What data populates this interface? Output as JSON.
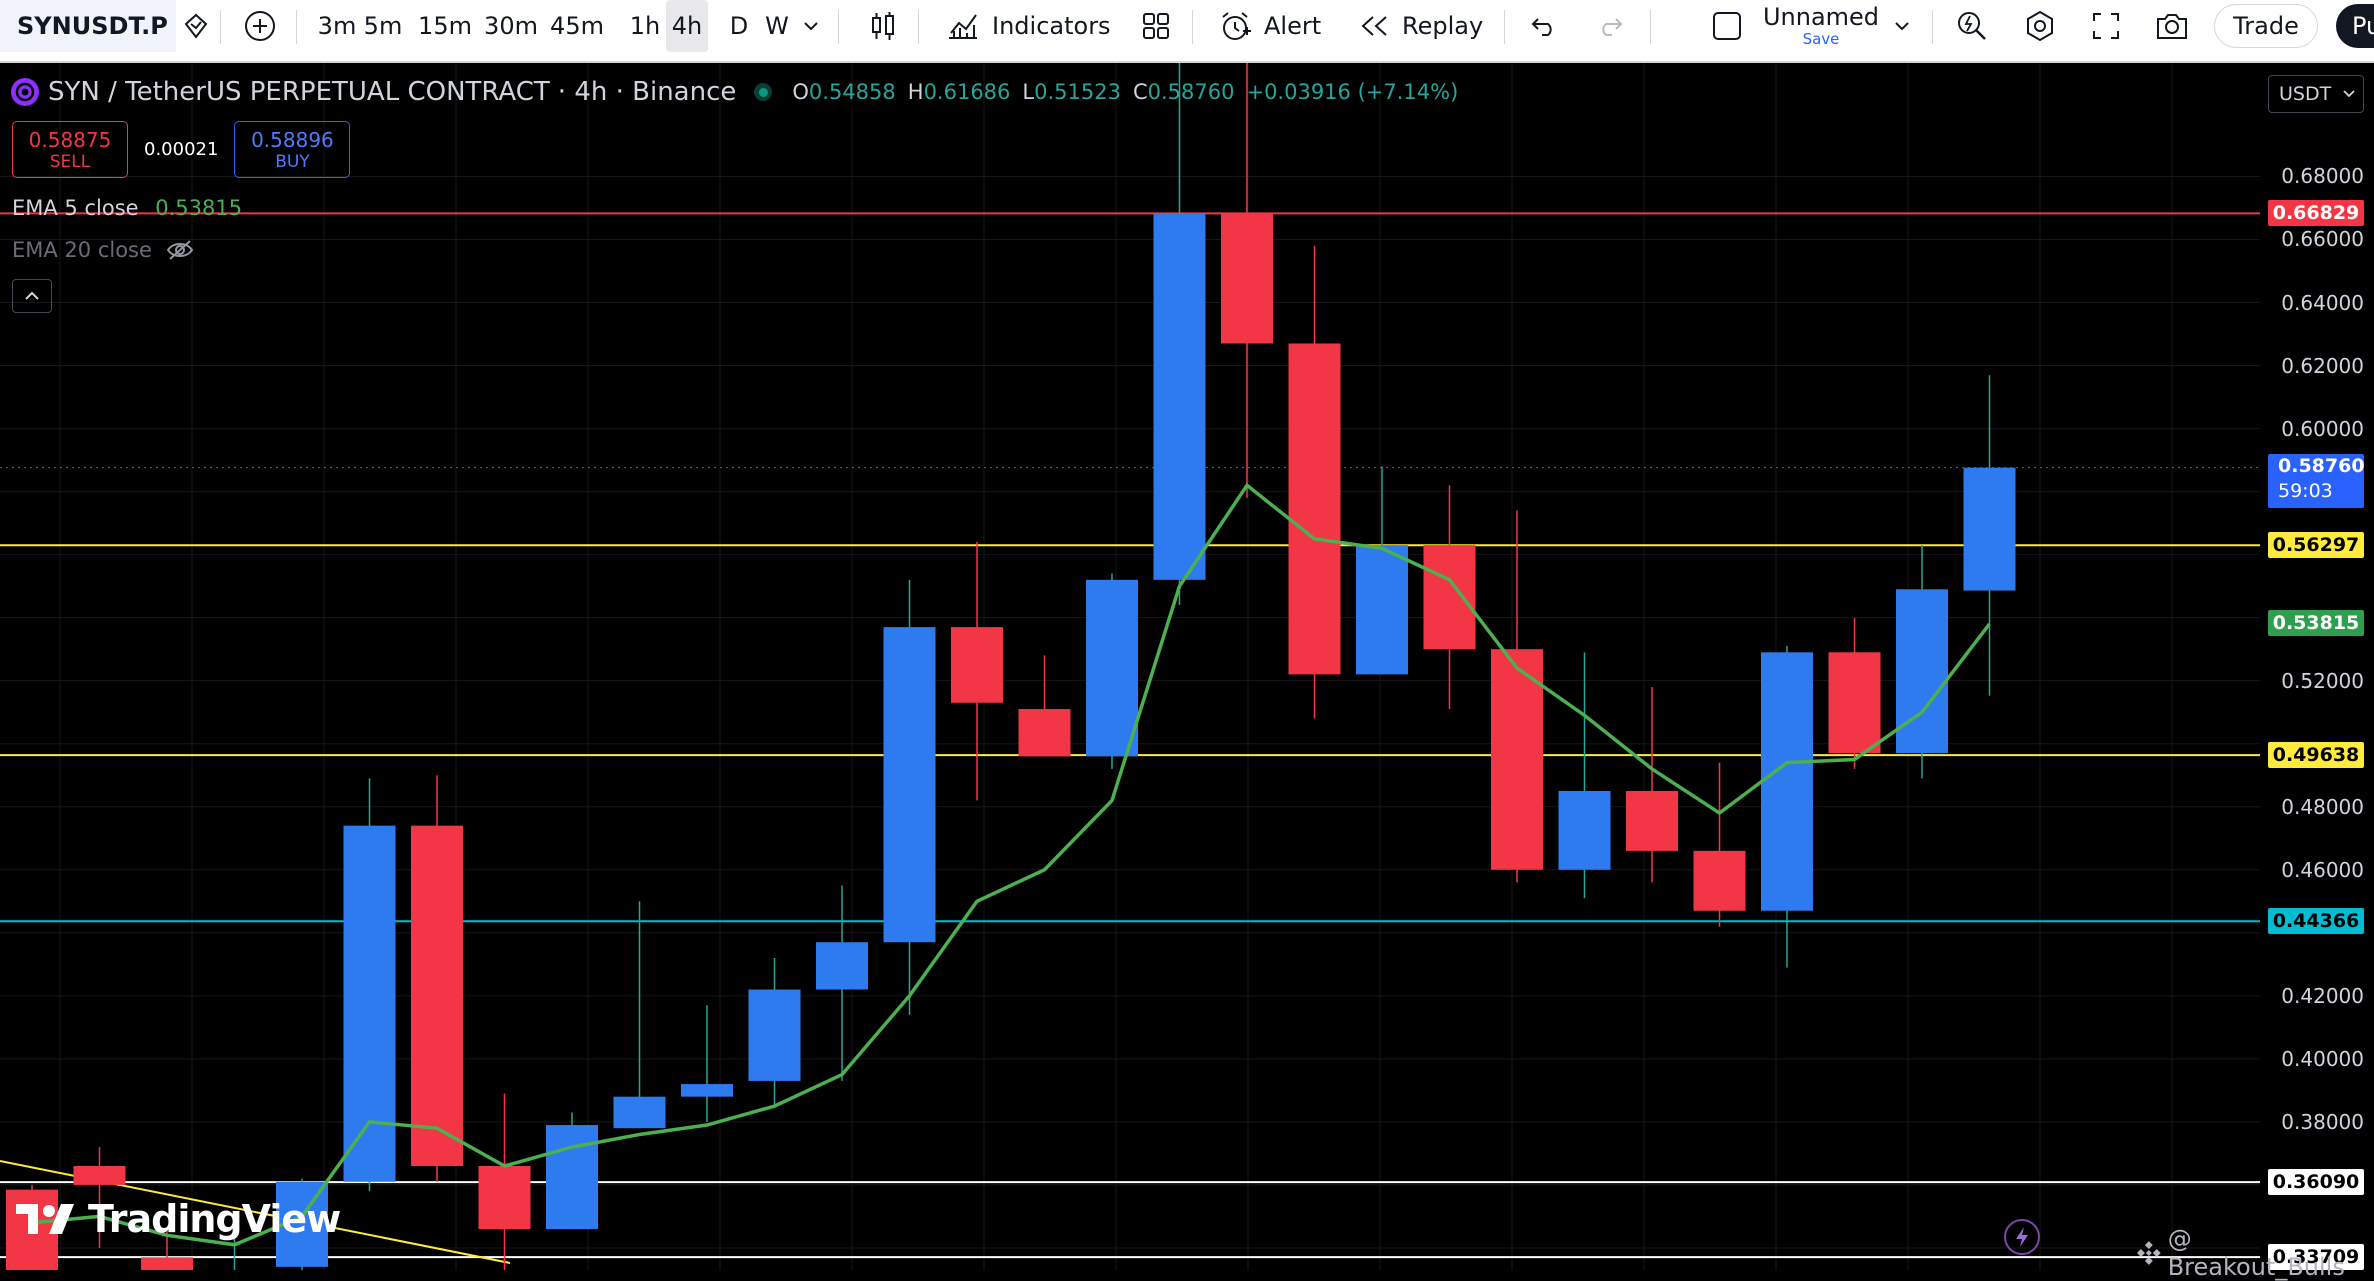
{
  "toolbar": {
    "symbol": "SYNUSDT.P",
    "intervals": [
      "3m",
      "5m",
      "15m",
      "30m",
      "45m",
      "1h",
      "4h",
      "D",
      "W"
    ],
    "active_interval": "4h",
    "indicators_label": "Indicators",
    "alert_label": "Alert",
    "replay_label": "Replay",
    "layout_name": "Unnamed",
    "layout_save_label": "Save",
    "trade_label": "Trade",
    "publish_label": "Pu"
  },
  "legend": {
    "symbol_title": "SYN / TetherUS PERPETUAL CONTRACT",
    "interval_exchange": "· 4h · Binance",
    "open_label": "O",
    "open_value": "0.54858",
    "high_label": "H",
    "high_value": "0.61686",
    "low_label": "L",
    "low_value": "0.51523",
    "close_label": "C",
    "close_value": "0.58760",
    "change": "+0.03916 (+7.14%)",
    "currency": "USDT"
  },
  "trade_box": {
    "sell_price": "0.58875",
    "sell_label": "SELL",
    "spread": "0.00021",
    "buy_price": "0.58896",
    "buy_label": "BUY"
  },
  "indicators": [
    {
      "name": "EMA 5 close",
      "value": "0.53815"
    },
    {
      "name": "EMA 20 close",
      "value": ""
    }
  ],
  "colors": {
    "up": "#2e7bef",
    "down": "#f23645",
    "ema": "#4caf50",
    "line_red": "#f23645",
    "line_yellow": "#ffeb3b",
    "line_cyan": "#00bcd4",
    "line_white": "#ffffff",
    "grid": "#161616"
  },
  "chart_data": {
    "type": "candlestick",
    "ylim": [
      0.333,
      0.716
    ],
    "y_ticks": [
      "0.68000",
      "0.66000",
      "0.64000",
      "0.62000",
      "0.60000",
      "0.52000",
      "0.48000",
      "0.46000",
      "0.42000",
      "0.40000",
      "0.38000"
    ],
    "candles": [
      {
        "o": 0.3585,
        "h": 0.36,
        "l": 0.333,
        "c": 0.333
      },
      {
        "o": 0.366,
        "h": 0.372,
        "l": 0.34,
        "c": 0.36
      },
      {
        "o": 0.337,
        "h": 0.346,
        "l": 0.333,
        "c": 0.333
      },
      {
        "o": 0.333,
        "h": 0.345,
        "l": 0.33,
        "c": 0.333
      },
      {
        "o": 0.334,
        "h": 0.362,
        "l": 0.333,
        "c": 0.361
      },
      {
        "o": 0.361,
        "h": 0.489,
        "l": 0.358,
        "c": 0.474
      },
      {
        "o": 0.474,
        "h": 0.49,
        "l": 0.361,
        "c": 0.366
      },
      {
        "o": 0.366,
        "h": 0.389,
        "l": 0.333,
        "c": 0.346
      },
      {
        "o": 0.346,
        "h": 0.383,
        "l": 0.346,
        "c": 0.379
      },
      {
        "o": 0.378,
        "h": 0.45,
        "l": 0.378,
        "c": 0.388
      },
      {
        "o": 0.388,
        "h": 0.417,
        "l": 0.38,
        "c": 0.392
      },
      {
        "o": 0.393,
        "h": 0.432,
        "l": 0.385,
        "c": 0.422
      },
      {
        "o": 0.422,
        "h": 0.455,
        "l": 0.393,
        "c": 0.437
      },
      {
        "o": 0.437,
        "h": 0.552,
        "l": 0.414,
        "c": 0.537
      },
      {
        "o": 0.537,
        "h": 0.564,
        "l": 0.482,
        "c": 0.513
      },
      {
        "o": 0.511,
        "h": 0.528,
        "l": 0.496,
        "c": 0.496
      },
      {
        "o": 0.496,
        "h": 0.554,
        "l": 0.492,
        "c": 0.552
      },
      {
        "o": 0.552,
        "h": 0.716,
        "l": 0.544,
        "c": 0.6683
      },
      {
        "o": 0.6683,
        "h": 0.716,
        "l": 0.578,
        "c": 0.627
      },
      {
        "o": 0.627,
        "h": 0.658,
        "l": 0.508,
        "c": 0.522
      },
      {
        "o": 0.522,
        "h": 0.588,
        "l": 0.522,
        "c": 0.563
      },
      {
        "o": 0.563,
        "h": 0.582,
        "l": 0.511,
        "c": 0.53
      },
      {
        "o": 0.53,
        "h": 0.574,
        "l": 0.456,
        "c": 0.46
      },
      {
        "o": 0.46,
        "h": 0.529,
        "l": 0.451,
        "c": 0.485
      },
      {
        "o": 0.485,
        "h": 0.518,
        "l": 0.456,
        "c": 0.466
      },
      {
        "o": 0.466,
        "h": 0.494,
        "l": 0.442,
        "c": 0.447
      },
      {
        "o": 0.447,
        "h": 0.531,
        "l": 0.429,
        "c": 0.529
      },
      {
        "o": 0.529,
        "h": 0.54,
        "l": 0.492,
        "c": 0.497
      },
      {
        "o": 0.497,
        "h": 0.563,
        "l": 0.489,
        "c": 0.549
      },
      {
        "o": 0.5486,
        "h": 0.6169,
        "l": 0.5152,
        "c": 0.5876
      }
    ],
    "ema5": [
      0.348,
      0.35,
      0.344,
      0.341,
      0.35,
      0.38,
      0.378,
      0.366,
      0.372,
      0.376,
      0.379,
      0.385,
      0.395,
      0.42,
      0.45,
      0.46,
      0.482,
      0.55,
      0.582,
      0.565,
      0.562,
      0.552,
      0.524,
      0.509,
      0.492,
      0.478,
      0.494,
      0.495,
      0.51,
      0.538
    ],
    "horizontal_lines": [
      {
        "price": 0.66829,
        "label": "0.66829",
        "color": "#f23645"
      },
      {
        "price": 0.56297,
        "label": "0.56297",
        "color": "#ffeb3b"
      },
      {
        "price": 0.49638,
        "label": "0.49638",
        "color": "#ffeb3b"
      },
      {
        "price": 0.44366,
        "label": "0.44366",
        "color": "#00bcd4"
      },
      {
        "price": 0.3609,
        "label": "0.36090",
        "color": "#ffffff"
      },
      {
        "price": 0.33709,
        "label": "0.33709",
        "color": "#ffffff"
      }
    ],
    "last_price": {
      "price": 0.5876,
      "label": "0.58760",
      "countdown": "59:03"
    },
    "ema_price_label": {
      "price": 0.53815,
      "label": "0.53815"
    }
  },
  "watermark": "TradingView",
  "author": "@ Breakout_Bulls"
}
